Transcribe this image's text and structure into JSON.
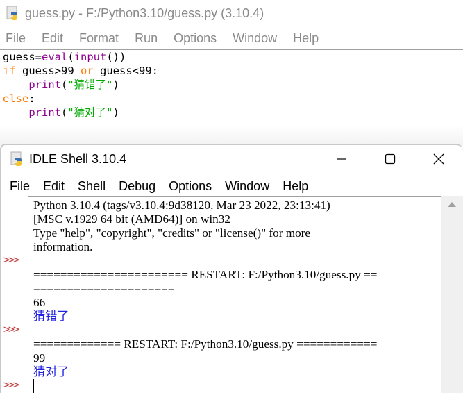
{
  "editor": {
    "title": "guess.py - F:/Python3.10/guess.py (3.10.4)",
    "menu": [
      "File",
      "Edit",
      "Format",
      "Run",
      "Options",
      "Window",
      "Help"
    ],
    "code": [
      [
        {
          "t": "guess=",
          "c": ""
        },
        {
          "t": "eval",
          "c": "bi"
        },
        {
          "t": "(",
          "c": ""
        },
        {
          "t": "input",
          "c": "bi"
        },
        {
          "t": "())",
          "c": ""
        }
      ],
      [
        {
          "t": "if",
          "c": "kw"
        },
        {
          "t": " guess>99 ",
          "c": ""
        },
        {
          "t": "or",
          "c": "kw"
        },
        {
          "t": " guess<99:",
          "c": ""
        }
      ],
      [
        {
          "t": "    ",
          "c": ""
        },
        {
          "t": "print",
          "c": "bi"
        },
        {
          "t": "(",
          "c": ""
        },
        {
          "t": "\"猜错了\"",
          "c": "str"
        },
        {
          "t": ")",
          "c": ""
        }
      ],
      [
        {
          "t": "else",
          "c": "kw"
        },
        {
          "t": ":",
          "c": ""
        }
      ],
      [
        {
          "t": "    ",
          "c": ""
        },
        {
          "t": "print",
          "c": "bi"
        },
        {
          "t": "(",
          "c": ""
        },
        {
          "t": "\"猜对了\"",
          "c": "str"
        },
        {
          "t": ")",
          "c": ""
        }
      ]
    ]
  },
  "shell": {
    "title": "IDLE Shell 3.10.4",
    "menu": [
      "File",
      "Edit",
      "Shell",
      "Debug",
      "Options",
      "Window",
      "Help"
    ],
    "prompt": ">>>",
    "lines": [
      {
        "text": "Python 3.10.4 (tags/v3.10.4:9d38120, Mar 23 2022, 23:13:41)",
        "kind": "plain"
      },
      {
        "text": "[MSC v.1929 64 bit (AMD64)] on win32",
        "kind": "plain"
      },
      {
        "text": "Type \"help\", \"copyright\", \"credits\" or \"license()\" for more",
        "kind": "plain"
      },
      {
        "text": "information.",
        "kind": "plain"
      },
      {
        "text": "",
        "kind": "prompt"
      },
      {
        "text": "======================= RESTART: F:/Python3.10/guess.py ==",
        "kind": "plain"
      },
      {
        "text": "=====================",
        "kind": "plain"
      },
      {
        "text": "66",
        "kind": "input"
      },
      {
        "text": "猜错了",
        "kind": "out"
      },
      {
        "text": "",
        "kind": "prompt"
      },
      {
        "text": "============= RESTART: F:/Python3.10/guess.py ============",
        "kind": "plain"
      },
      {
        "text": "99",
        "kind": "input"
      },
      {
        "text": "猜对了",
        "kind": "out"
      },
      {
        "text": "",
        "kind": "prompt-cursor"
      }
    ]
  },
  "icons": {
    "python_file": "python-file-icon",
    "minimize": "minimize-icon",
    "maximize": "maximize-icon",
    "close": "close-icon",
    "scroll_up": "scroll-up-arrow-icon"
  },
  "colors": {
    "keyword": "#ff7700",
    "builtin": "#900090",
    "string": "#00aa00",
    "output": "#2020e0",
    "prompt": "#c04040"
  }
}
